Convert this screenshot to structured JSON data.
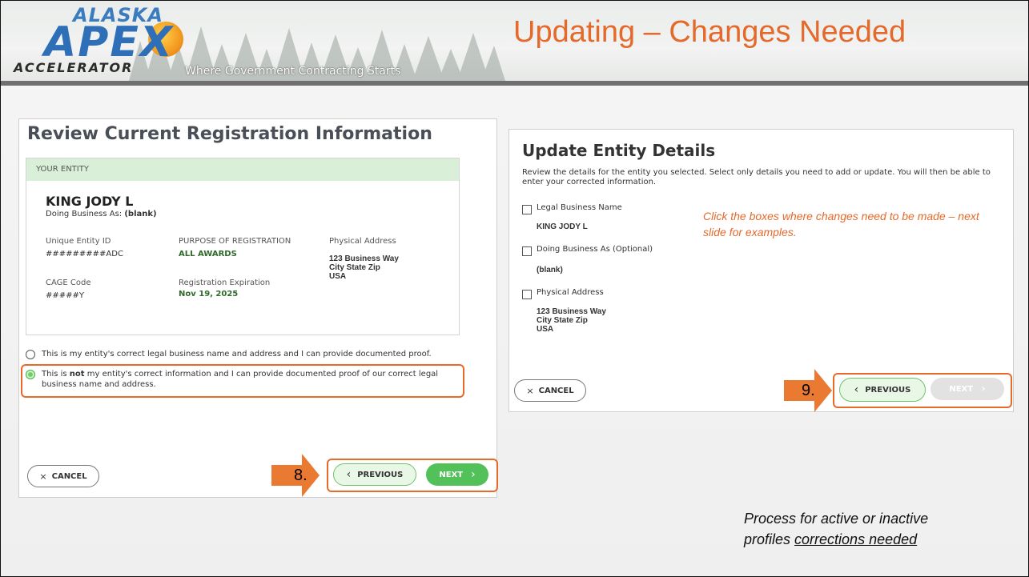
{
  "header": {
    "logo_top": "ALASKA",
    "logo_main": "APEX",
    "logo_bottom": "ACCELERATOR",
    "tagline": "Where Government Contracting Starts",
    "title": "Updating – Changes Needed"
  },
  "left_panel": {
    "heading": "Review Current Registration Information",
    "entity_header": "YOUR ENTITY",
    "entity_name": "KING JODY L",
    "dba_label": "Doing Business As:",
    "dba_value": "(blank)",
    "uei_label": "Unique Entity ID",
    "uei_value": "#########ADC",
    "purpose_label": "PURPOSE OF REGISTRATION",
    "purpose_value": "ALL AWARDS",
    "address_label": "Physical Address",
    "address_line1": "123 Business Way",
    "address_line2": "City State Zip",
    "address_line3": "USA",
    "cage_label": "CAGE Code",
    "cage_value": "#####Y",
    "expiration_label": "Registration Expiration",
    "expiration_value": "Nov 19, 2025",
    "option1": "This is my entity's correct legal business name and address and I can provide documented proof.",
    "option2_pre": "This is ",
    "option2_bold": "not",
    "option2_post": " my entity's correct information and I can provide documented proof of our correct legal business name and address.",
    "cancel_label": "CANCEL",
    "previous_label": "PREVIOUS",
    "next_label": "NEXT",
    "step_number": "8."
  },
  "right_panel": {
    "heading": "Update Entity Details",
    "description": "Review the details for the entity you selected. Select only details you need to add or update. You will then be able to enter your corrected information.",
    "legal_name_label": "Legal Business Name",
    "legal_name_value": "KING JODY L",
    "dba_label": "Doing Business As (Optional)",
    "dba_value": "(blank)",
    "address_label": "Physical Address",
    "address_line1": "123 Business Way",
    "address_line2": "City State Zip",
    "address_line3": "USA",
    "note": "Click the boxes where changes need to be made – next slide for examples.",
    "cancel_label": "CANCEL",
    "previous_label": "PREVIOUS",
    "next_label": "NEXT",
    "step_number": "9."
  },
  "footer_note": {
    "line1": "Process for active or inactive",
    "line2_pre": "profiles ",
    "line2_underlined": "corrections needed"
  },
  "colors": {
    "accent_orange": "#e4692a",
    "success_green": "#52c15a",
    "entity_header_bg": "#d9efd7"
  },
  "icons": {
    "cancel": "close-icon",
    "previous": "chevron-left-icon",
    "next": "chevron-right-icon"
  }
}
